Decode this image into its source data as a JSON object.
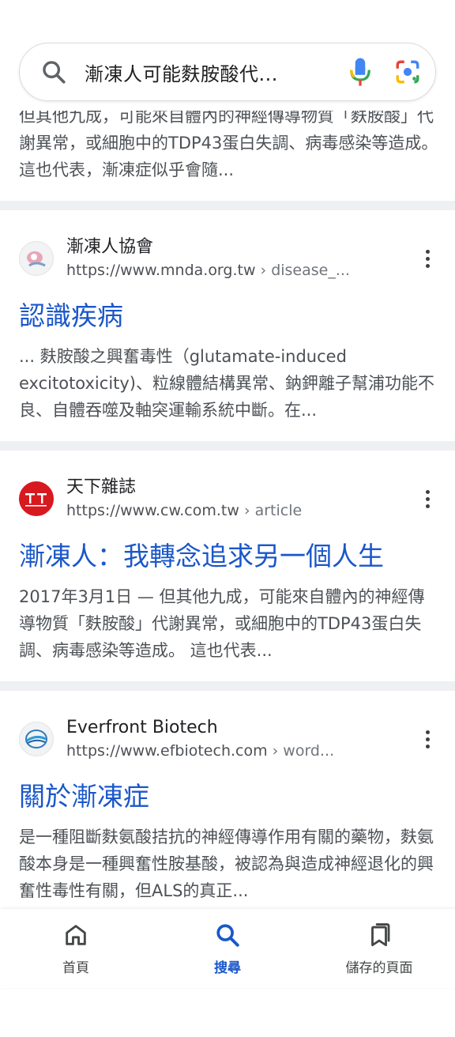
{
  "search": {
    "query": "漸凍人可能麩胺酸代..."
  },
  "top_snippet": "但其他九成，可能來自體內的神經傳導物質「麩胺酸」代謝異常，或細胞中的TDP43蛋白失調、病毒感染等造成。 這也代表，漸凍症似乎會隨...",
  "results": [
    {
      "site_name": "漸凍人協會",
      "url_base": "https://www.mnda.org.tw",
      "url_path": " › disease_...",
      "title": "認識疾病",
      "snippet": "... 麩胺酸之興奮毒性（glutamate-induced excitotoxicity)、粒線體結構異常、鈉鉀離子幫浦功能不良、自體吞噬及軸突運輸系統中斷。在..."
    },
    {
      "site_name": "天下雜誌",
      "url_base": "https://www.cw.com.tw",
      "url_path": " › article",
      "title": "漸凍人：我轉念追求另一個人生",
      "snippet": "2017年3月1日 — 但其他九成，可能來自體內的神經傳導物質「麩胺酸」代謝異常，或細胞中的TDP43蛋白失調、病毒感染等造成。 這也代表..."
    },
    {
      "site_name": "Everfront Biotech",
      "url_base": "https://www.efbiotech.com",
      "url_path": " › word...",
      "title": "關於漸凍症",
      "snippet": "是一種阻斷麩氨酸拮抗的神經傳導作用有關的藥物，麩氨酸本身是一種興奮性胺基酸，被認為與造成神經退化的興奮性毒性有關，但ALS的真正..."
    }
  ],
  "bottom_nav": {
    "home": "首頁",
    "search": "搜尋",
    "saved": "儲存的頁面"
  },
  "colors": {
    "link": "#1a57c9",
    "separator": "#eef0f3",
    "snippet": "#4d5156",
    "cw_red": "#d71920"
  }
}
